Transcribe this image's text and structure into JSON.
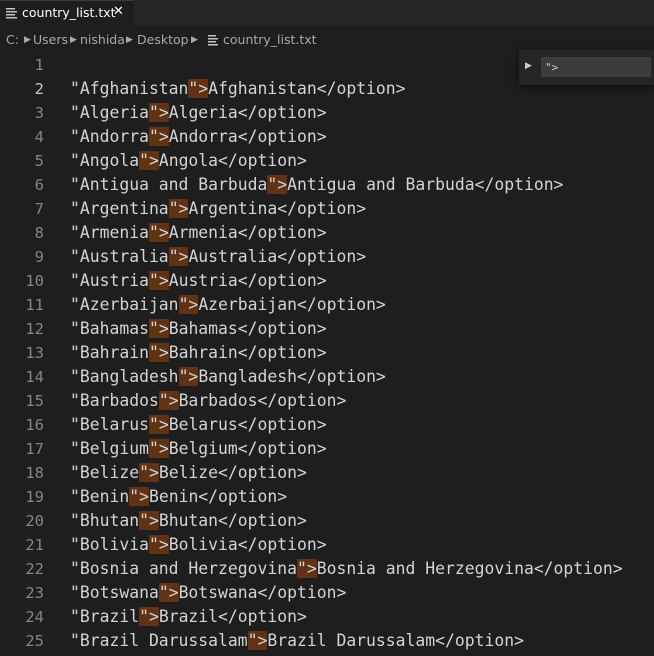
{
  "tab": {
    "filename": "country_list.txt",
    "close_glyph": "✕",
    "icon": "file-lines-icon"
  },
  "breadcrumb": {
    "items": [
      "C:",
      "Users",
      "nishida",
      "Desktop",
      "country_list.txt"
    ],
    "separator_icon": "chevron-right-icon",
    "file_icon": "file-lines-icon"
  },
  "find": {
    "toggle_icon": "chevron-right-icon",
    "value": "\">"
  },
  "editor": {
    "active_line": 2,
    "highlight_color": "#613214",
    "lines": [
      {
        "n": "1",
        "pre": "",
        "match": "",
        "post": ""
      },
      {
        "n": "2",
        "pre": "\"Afghanistan",
        "match": "\">",
        "post": "Afghanistan</option>"
      },
      {
        "n": "3",
        "pre": "\"Algeria",
        "match": "\">",
        "post": "Algeria</option>"
      },
      {
        "n": "4",
        "pre": "\"Andorra",
        "match": "\">",
        "post": "Andorra</option>"
      },
      {
        "n": "5",
        "pre": "\"Angola",
        "match": "\">",
        "post": "Angola</option>"
      },
      {
        "n": "6",
        "pre": "\"Antigua and Barbuda",
        "match": "\">",
        "post": "Antigua and Barbuda</option>"
      },
      {
        "n": "7",
        "pre": "\"Argentina",
        "match": "\">",
        "post": "Argentina</option>"
      },
      {
        "n": "8",
        "pre": "\"Armenia",
        "match": "\">",
        "post": "Armenia</option>"
      },
      {
        "n": "9",
        "pre": "\"Australia",
        "match": "\">",
        "post": "Australia</option>"
      },
      {
        "n": "10",
        "pre": "\"Austria",
        "match": "\">",
        "post": "Austria</option>"
      },
      {
        "n": "11",
        "pre": "\"Azerbaijan",
        "match": "\">",
        "post": "Azerbaijan</option>"
      },
      {
        "n": "12",
        "pre": "\"Bahamas",
        "match": "\">",
        "post": "Bahamas</option>"
      },
      {
        "n": "13",
        "pre": "\"Bahrain",
        "match": "\">",
        "post": "Bahrain</option>"
      },
      {
        "n": "14",
        "pre": "\"Bangladesh",
        "match": "\">",
        "post": "Bangladesh</option>"
      },
      {
        "n": "15",
        "pre": "\"Barbados",
        "match": "\">",
        "post": "Barbados</option>"
      },
      {
        "n": "16",
        "pre": "\"Belarus",
        "match": "\">",
        "post": "Belarus</option>"
      },
      {
        "n": "17",
        "pre": "\"Belgium",
        "match": "\">",
        "post": "Belgium</option>"
      },
      {
        "n": "18",
        "pre": "\"Belize",
        "match": "\">",
        "post": "Belize</option>"
      },
      {
        "n": "19",
        "pre": "\"Benin",
        "match": "\">",
        "post": "Benin</option>"
      },
      {
        "n": "20",
        "pre": "\"Bhutan",
        "match": "\">",
        "post": "Bhutan</option>"
      },
      {
        "n": "21",
        "pre": "\"Bolivia",
        "match": "\">",
        "post": "Bolivia</option>"
      },
      {
        "n": "22",
        "pre": "\"Bosnia and Herzegovina",
        "match": "\">",
        "post": "Bosnia and Herzegovina</option>"
      },
      {
        "n": "23",
        "pre": "\"Botswana",
        "match": "\">",
        "post": "Botswana</option>"
      },
      {
        "n": "24",
        "pre": "\"Brazil",
        "match": "\">",
        "post": "Brazil</option>"
      },
      {
        "n": "25",
        "pre": "\"Brazil Darussalam",
        "match": "\">",
        "post": "Brazil Darussalam</option>"
      }
    ]
  }
}
